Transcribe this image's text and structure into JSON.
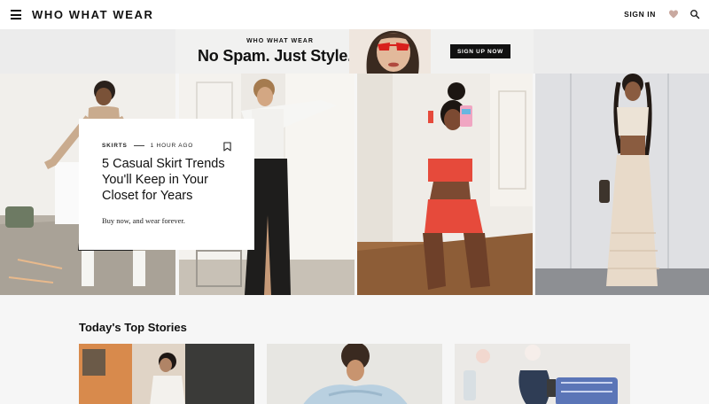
{
  "header": {
    "logo": "WHO WHAT WEAR",
    "signin_label": "SIGN IN",
    "icons": [
      "menu-icon",
      "heart-icon",
      "search-icon"
    ]
  },
  "banner": {
    "kicker": "WHO WHAT WEAR",
    "headline": "No Spam. Just Style.",
    "cta": "SIGN UP NOW"
  },
  "feature": {
    "category": "SKIRTS",
    "time": "1 HOUR AGO",
    "title": "5 Casual Skirt Trends You'll Keep in Your Closet for Years",
    "dek": "Buy now, and wear forever."
  },
  "top_stories": {
    "title": "Today's Top Stories"
  },
  "colors": {
    "accent_red": "#e64a3b",
    "heart": "#c9a9a0",
    "banner_bg": "#f1f1f0",
    "cta_bg": "#111111"
  }
}
